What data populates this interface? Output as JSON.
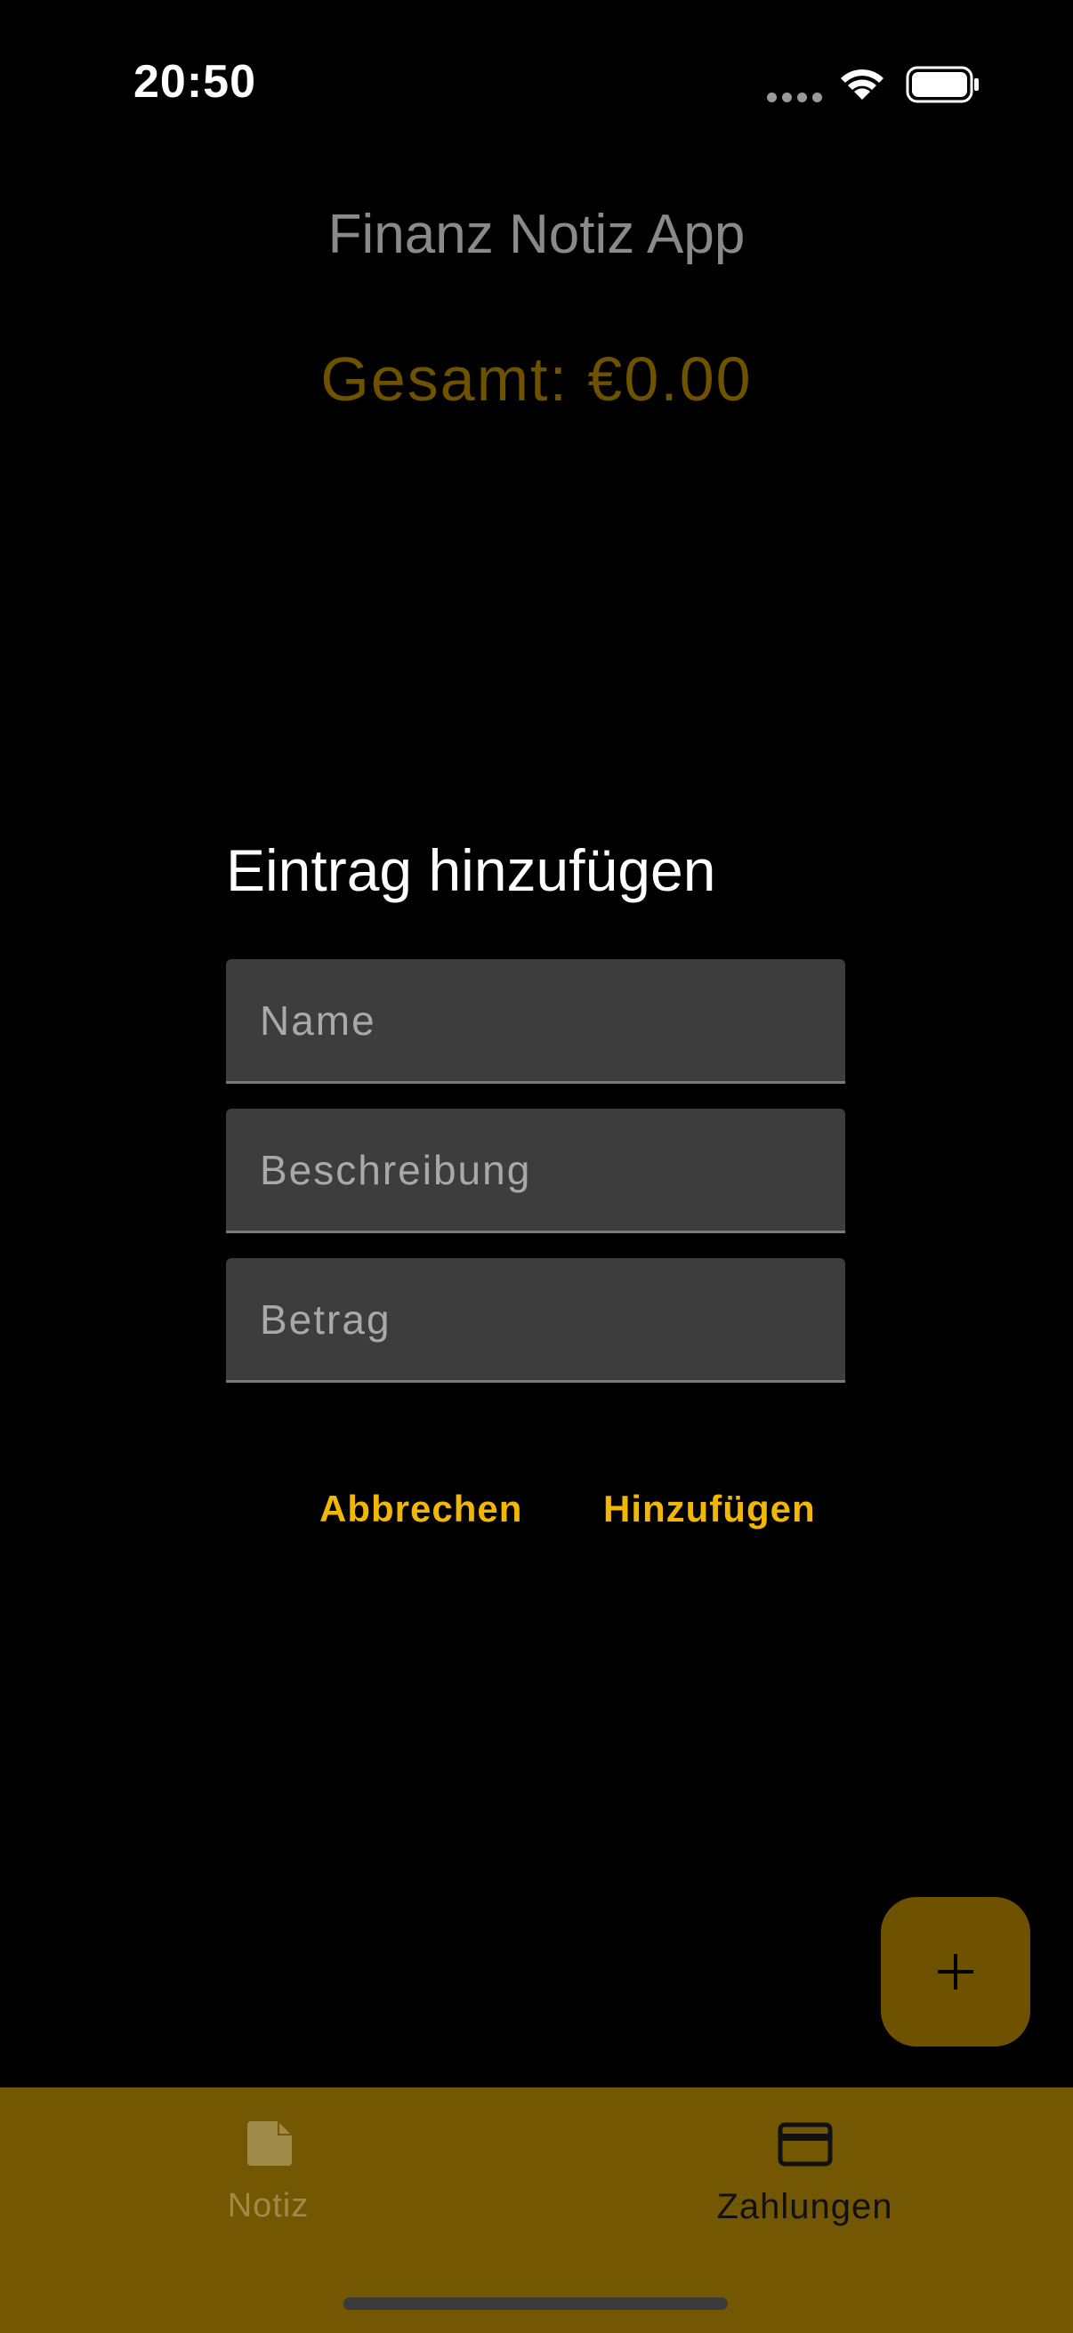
{
  "status_bar": {
    "time": "20:50"
  },
  "header": {
    "title": "Finanz Notiz App",
    "total": "Gesamt: €0.00"
  },
  "dialog": {
    "title": "Eintrag hinzufügen",
    "fields": {
      "name_placeholder": "Name",
      "description_placeholder": "Beschreibung",
      "amount_placeholder": "Betrag"
    },
    "cancel_label": "Abbrechen",
    "add_label": "Hinzufügen"
  },
  "fab": {
    "icon": "plus-icon"
  },
  "bottom_nav": {
    "items": [
      {
        "label": "Notiz",
        "icon": "note-icon",
        "selected": false
      },
      {
        "label": "Zahlungen",
        "icon": "credit-card-icon",
        "selected": true
      }
    ]
  },
  "colors": {
    "background": "#000000",
    "accent": "#f2b705",
    "accent_dim": "#6e5200",
    "nav_background": "#735702",
    "field_background": "#3d3d3d"
  }
}
